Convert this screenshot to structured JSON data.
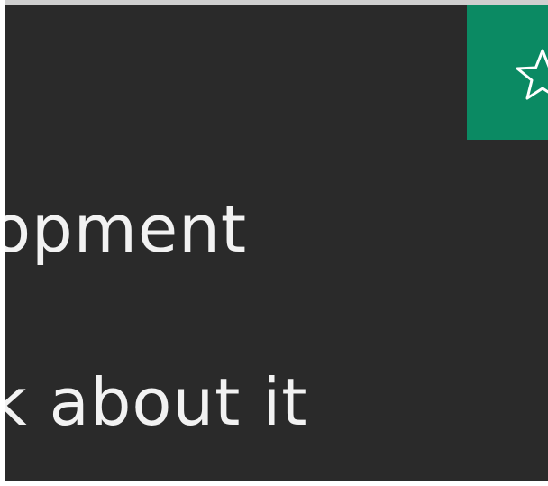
{
  "content": {
    "line1": "opment",
    "line2": "k about it"
  },
  "star_button": {
    "icon": "star-outline-icon"
  },
  "colors": {
    "background": "#2a2a2a",
    "accent": "#0b8a63",
    "text": "#f2f2f2"
  }
}
